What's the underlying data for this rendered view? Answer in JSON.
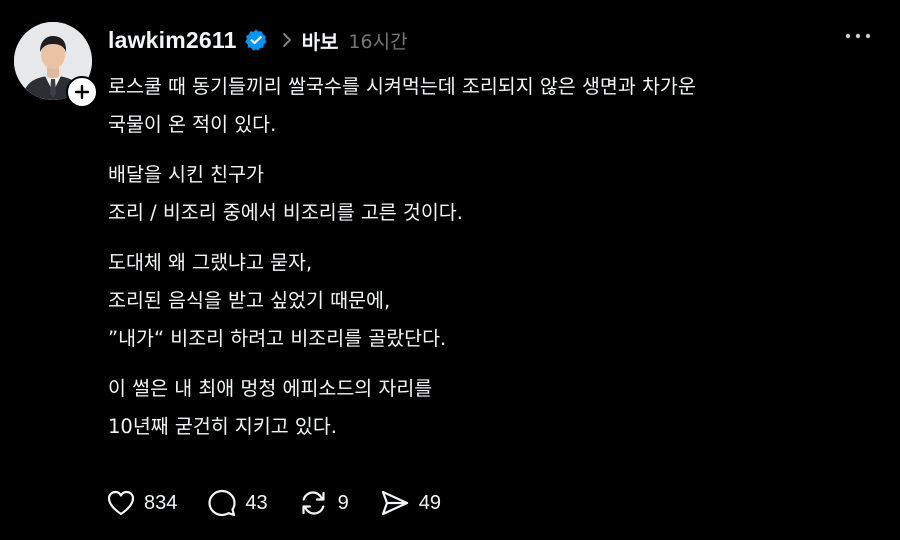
{
  "post": {
    "username": "lawkim2611",
    "topic": "바보",
    "timestamp": "16시간",
    "verified_icon": "verified-badge-icon",
    "follow_icon": "plus-icon",
    "paragraphs": [
      {
        "lines": [
          "로스쿨 때 동기들끼리 쌀국수를 시켜먹는데 조리되지 않은 생면과 차가운",
          "국물이 온 적이 있다."
        ]
      },
      {
        "lines": [
          "배달을 시킨 친구가",
          "조리 / 비조리 중에서 비조리를 고른 것이다."
        ]
      },
      {
        "lines": [
          "도대체 왜 그랬냐고 묻자,",
          "조리된 음식을 받고 싶었기 때문에,",
          "”내가“ 비조리 하려고 비조리를 골랐단다."
        ]
      },
      {
        "lines": [
          "이 썰은 내 최애 멍청 에피소드의 자리를",
          "10년째 굳건히 지키고 있다."
        ]
      }
    ],
    "actions": {
      "likes": "834",
      "replies": "43",
      "reposts": "9",
      "shares": "49"
    }
  },
  "colors": {
    "background": "#000000",
    "text": "#f3f5f7",
    "muted": "#777777",
    "verified": "#0095f6"
  }
}
